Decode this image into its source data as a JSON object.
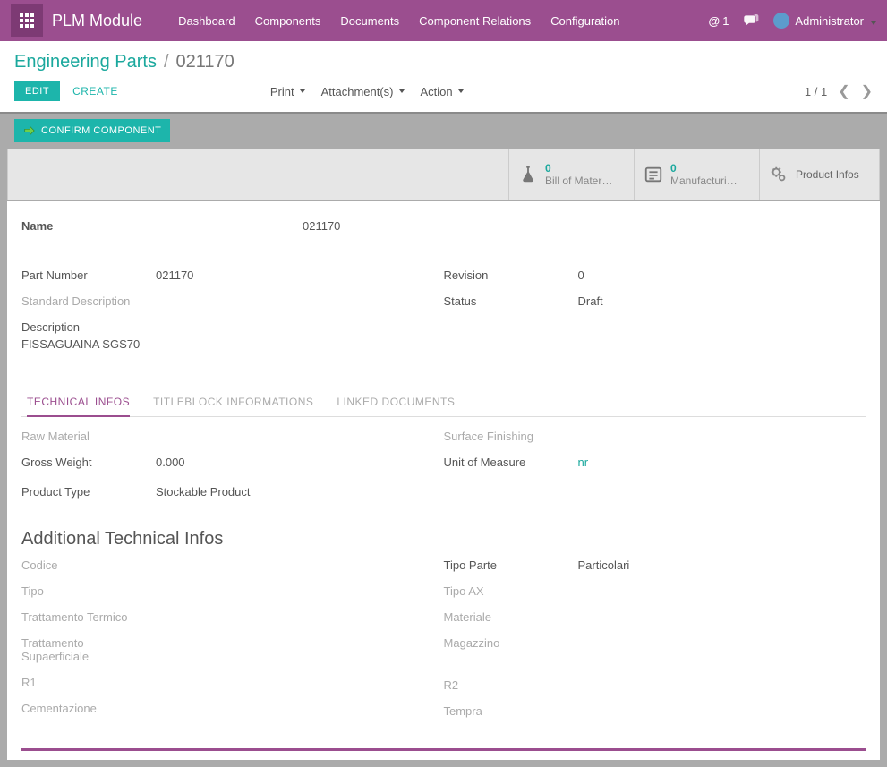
{
  "navbar": {
    "brand": "PLM Module",
    "menu": [
      "Dashboard",
      "Components",
      "Documents",
      "Component Relations",
      "Configuration"
    ],
    "msg_count": "1",
    "user_name": "Administrator"
  },
  "breadcrumb": {
    "parent": "Engineering Parts",
    "current": "021170"
  },
  "actions": {
    "edit": "EDIT",
    "create": "CREATE",
    "print": "Print",
    "attachments": "Attachment(s)",
    "action": "Action",
    "pager": "1 / 1"
  },
  "confirm_btn": "CONFIRM COMPONENT",
  "stat_buttons": {
    "bom": {
      "count": "0",
      "label": "Bill of Mater…"
    },
    "mfg": {
      "count": "0",
      "label": "Manufacturi…"
    },
    "prodinfo": {
      "label": "Product Infos"
    }
  },
  "fields": {
    "name_lbl": "Name",
    "name_val": "021170",
    "partnum_lbl": "Part Number",
    "partnum_val": "021170",
    "stddesc_lbl": "Standard Description",
    "desc_lbl": "Description",
    "desc_val": "FISSAGUAINA SGS70",
    "rev_lbl": "Revision",
    "rev_val": "0",
    "status_lbl": "Status",
    "status_val": "Draft"
  },
  "tabs": {
    "t1": "TECHNICAL INFOS",
    "t2": "TITLEBLOCK INFORMATIONS",
    "t3": "LINKED DOCUMENTS"
  },
  "tech": {
    "raw_lbl": "Raw Material",
    "gross_lbl": "Gross Weight",
    "gross_val": "0.000",
    "prodtype_lbl": "Product Type",
    "prodtype_val": "Stockable Product",
    "surf_lbl": "Surface Finishing",
    "uom_lbl": "Unit of Measure",
    "uom_val": "nr",
    "section_h": "Additional Technical Infos",
    "codice_lbl": "Codice",
    "tipo_lbl": "Tipo",
    "tratt_term_lbl": "Trattamento Termico",
    "tratt_sup_lbl": "Trattamento Supaerficiale",
    "r1_lbl": "R1",
    "cement_lbl": "Cementazione",
    "tipoparte_lbl": "Tipo Parte",
    "tipoparte_val": "Particolari",
    "tipoax_lbl": "Tipo AX",
    "materiale_lbl": "Materiale",
    "magazzino_lbl": "Magazzino",
    "r2_lbl": "R2",
    "tempra_lbl": "Tempra"
  }
}
